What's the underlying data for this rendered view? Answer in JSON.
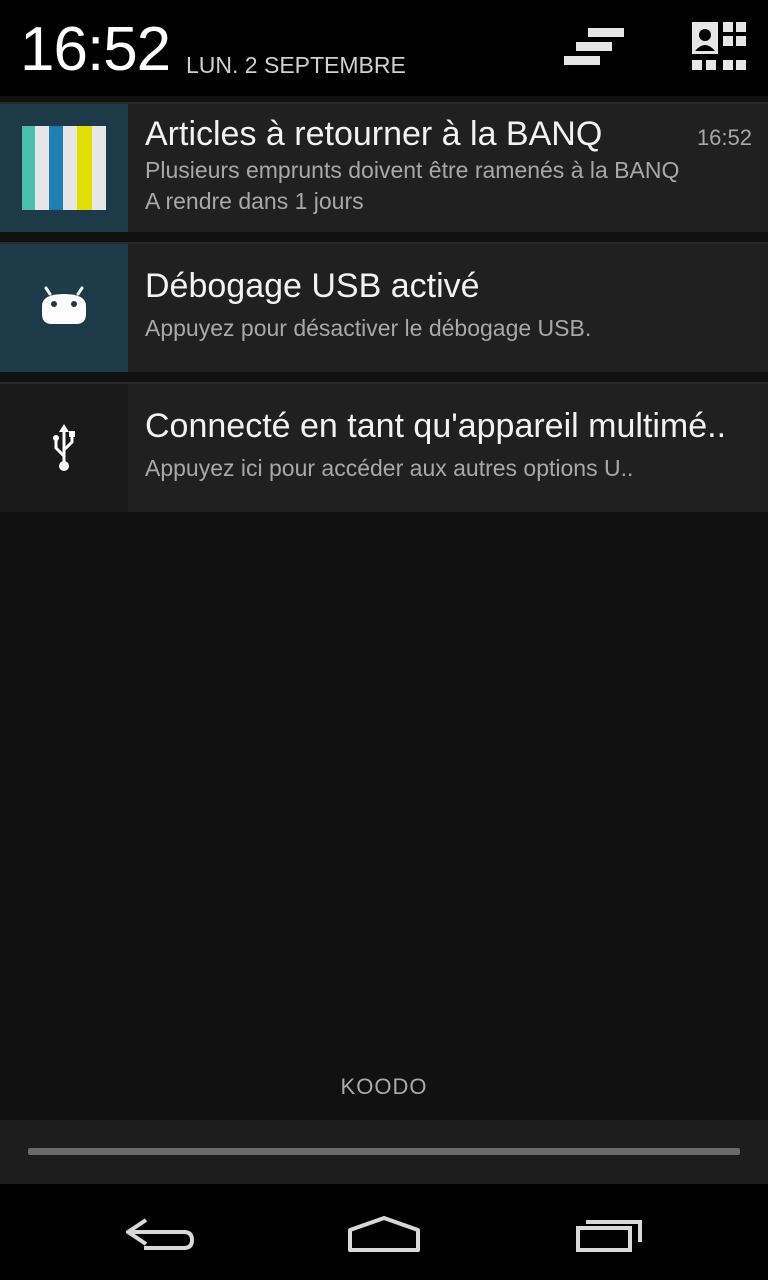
{
  "header": {
    "time": "16:52",
    "date": "LUN. 2 SEPTEMBRE",
    "clear_icon": "clear-all-icon",
    "quick_settings_icon": "quick-settings-icon"
  },
  "notifications": [
    {
      "icon": "library-books-icon",
      "title": "Articles à retourner à la BANQ",
      "line1": "Plusieurs emprunts doivent être ramenés à la BANQ",
      "line2": "A rendre dans 1 jours",
      "time": "16:52"
    },
    {
      "icon": "android-debug-icon",
      "title": "Débogage USB activé",
      "line1": "Appuyez pour désactiver le débogage USB."
    },
    {
      "icon": "usb-icon",
      "title": "Connecté en tant qu'appareil multimé..",
      "line1": "Appuyez ici pour accéder aux autres options U.."
    }
  ],
  "carrier": "KOODO",
  "navbar": {
    "back_icon": "back-icon",
    "home_icon": "home-icon",
    "recent_icon": "recent-apps-icon"
  },
  "colors": {
    "background": "#111111",
    "card": "#202020",
    "icon_teal": "#1c3a47",
    "bar_teal": "#4dbfb0",
    "bar_blue": "#1e7fb8",
    "bar_yellow": "#e2e000",
    "bar_light": "#e6e6e6"
  }
}
